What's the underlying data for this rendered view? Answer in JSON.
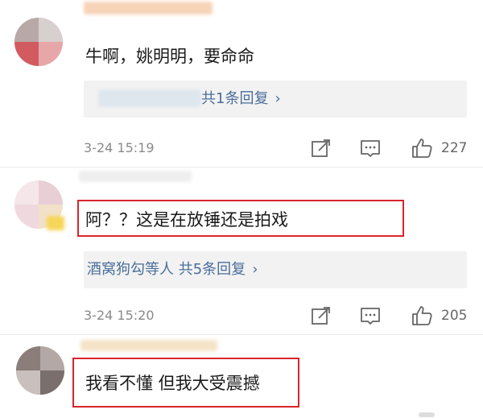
{
  "comments": [
    {
      "text": "牛啊，姚明明，要命命",
      "reply": {
        "prefix": "",
        "count_text": "共1条回复",
        "chevron": "›"
      },
      "time": "3-24 15:19",
      "likes": "227"
    },
    {
      "text": "阿？？这是在放锤还是拍戏",
      "reply": {
        "prefix": "酒窝狗勾等人",
        "count_text": "共5条回复",
        "chevron": "›"
      },
      "time": "3-24 15:20",
      "likes": "205"
    },
    {
      "text": "我看不懂 但我大受震撼"
    }
  ],
  "icons": [
    "edit-icon",
    "comment-icon",
    "like-icon"
  ],
  "colors": {
    "highlight": "#d9252b",
    "link": "#4a6e9b",
    "reply_bg": "#f2f2f2",
    "meta": "#8a8a8a"
  }
}
